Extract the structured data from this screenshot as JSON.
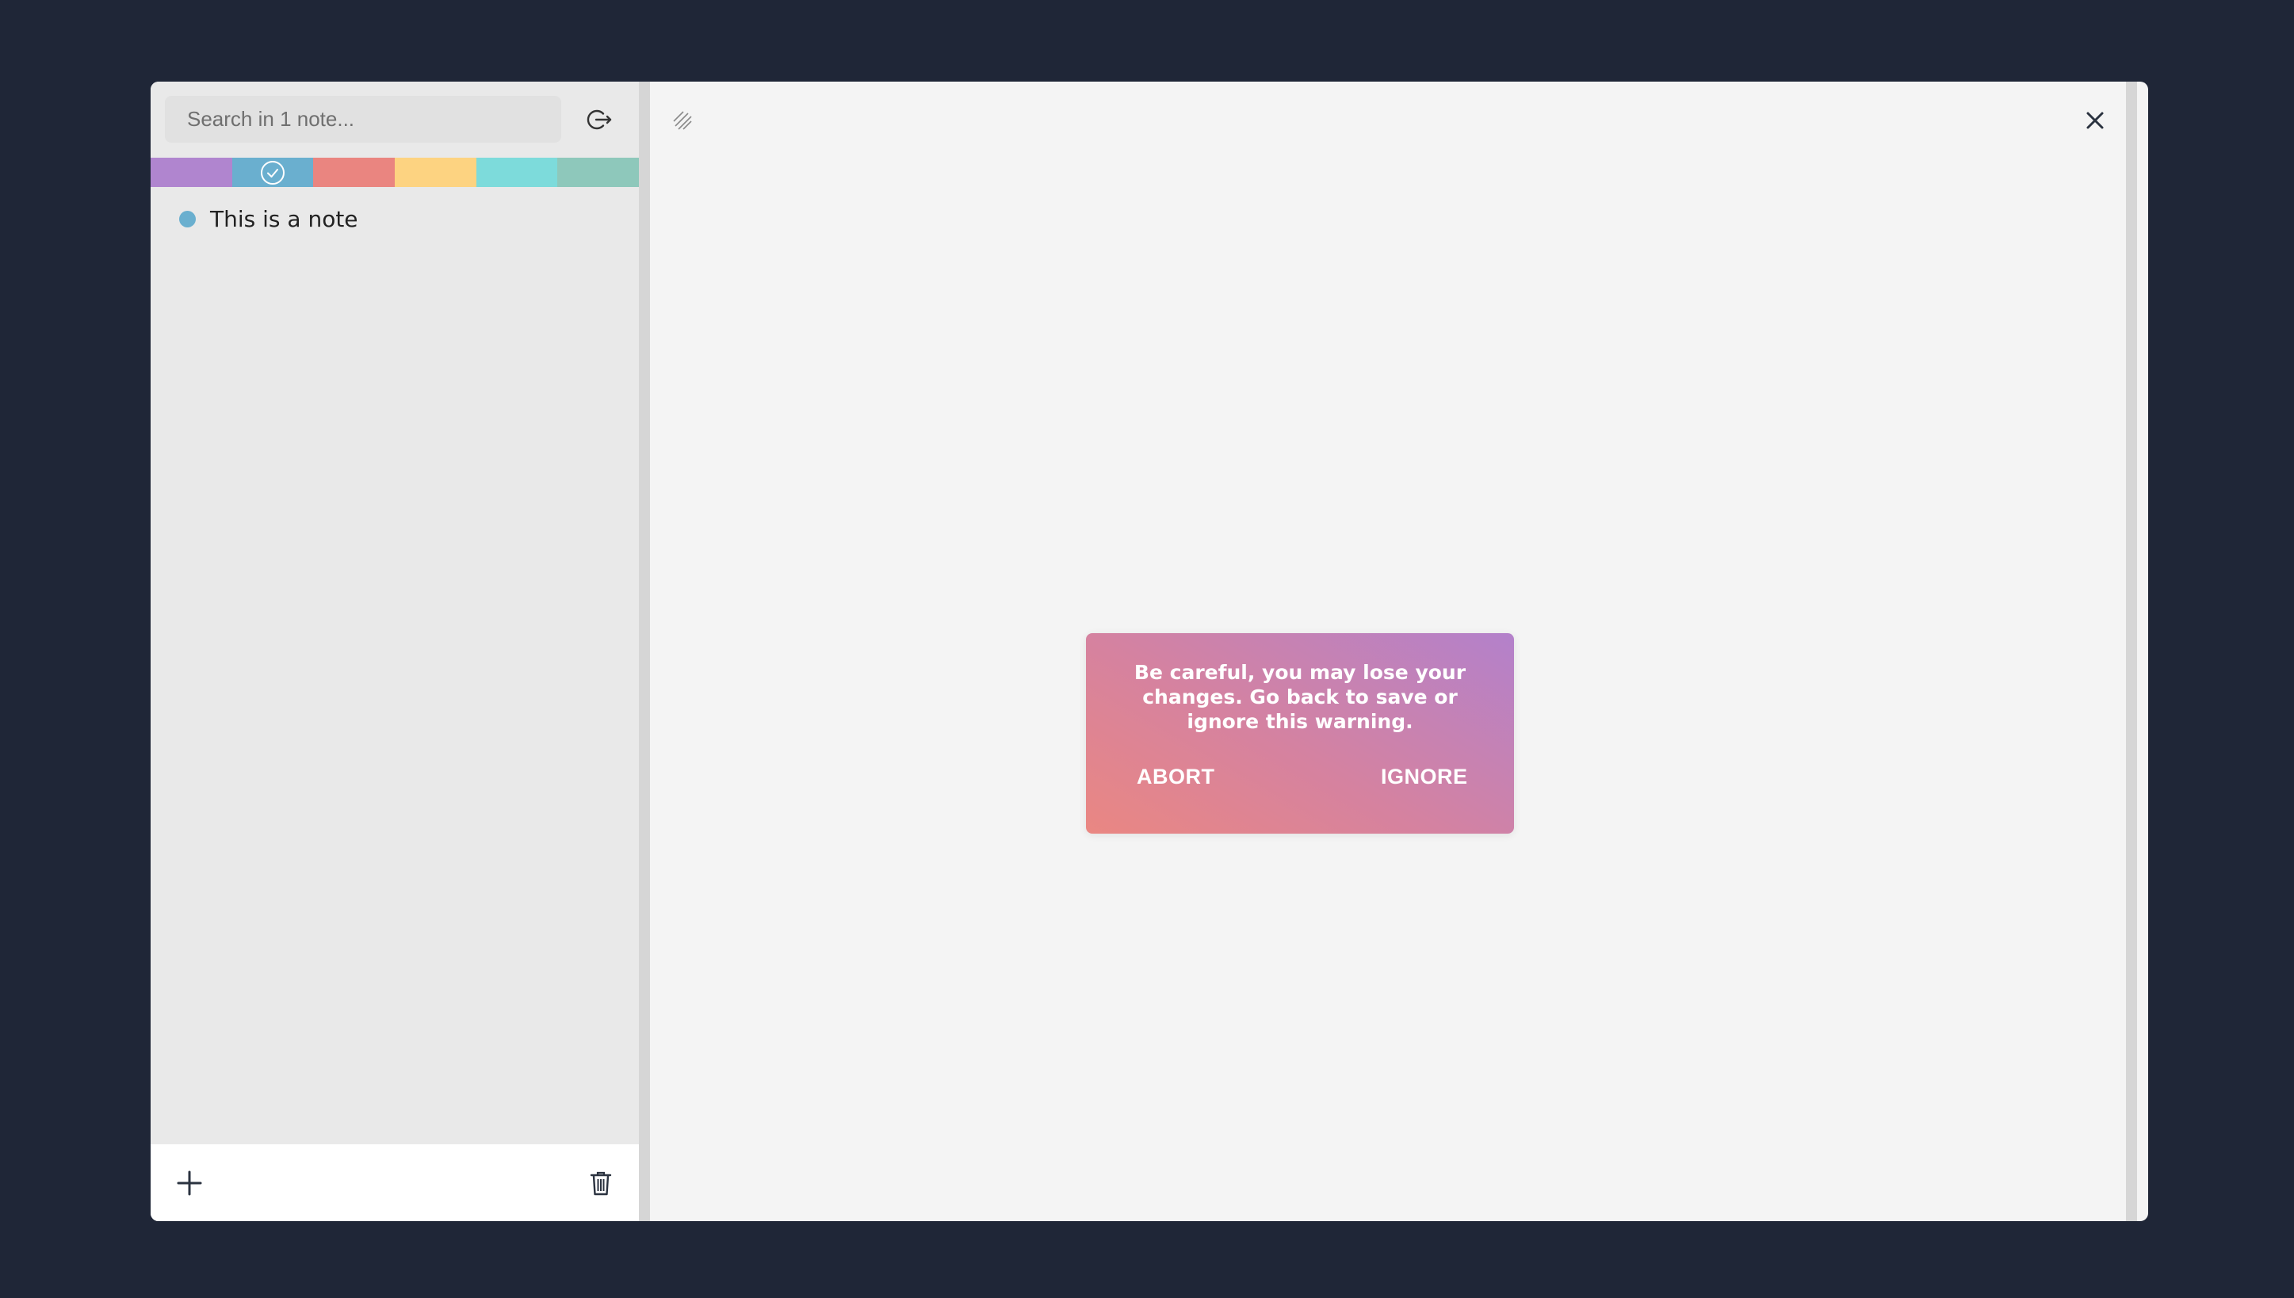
{
  "search": {
    "placeholder": "Search in 1 note..."
  },
  "sidebar": {
    "colors": [
      {
        "name": "purple",
        "hex": "#b085cf",
        "selected": false
      },
      {
        "name": "blue",
        "hex": "#6aafcf",
        "selected": true
      },
      {
        "name": "red",
        "hex": "#ea8580",
        "selected": false
      },
      {
        "name": "yellow",
        "hex": "#fdd381",
        "selected": false
      },
      {
        "name": "cyan",
        "hex": "#7ddbdb",
        "selected": false
      },
      {
        "name": "teal",
        "hex": "#8ec8bb",
        "selected": false
      }
    ],
    "notes": [
      {
        "title": "This is a note",
        "color": "#6aafcf"
      }
    ],
    "icons": {
      "logout": "logout-icon",
      "add": "plus-icon",
      "delete": "trash-icon",
      "selected": "check-circle-icon"
    }
  },
  "editor": {
    "icons": {
      "resize": "resize-handle-icon",
      "close": "close-icon"
    }
  },
  "modal": {
    "message": "Be careful, you may lose your changes. Go back to save or ignore this warning.",
    "abort_label": "ABORT",
    "ignore_label": "IGNORE"
  }
}
